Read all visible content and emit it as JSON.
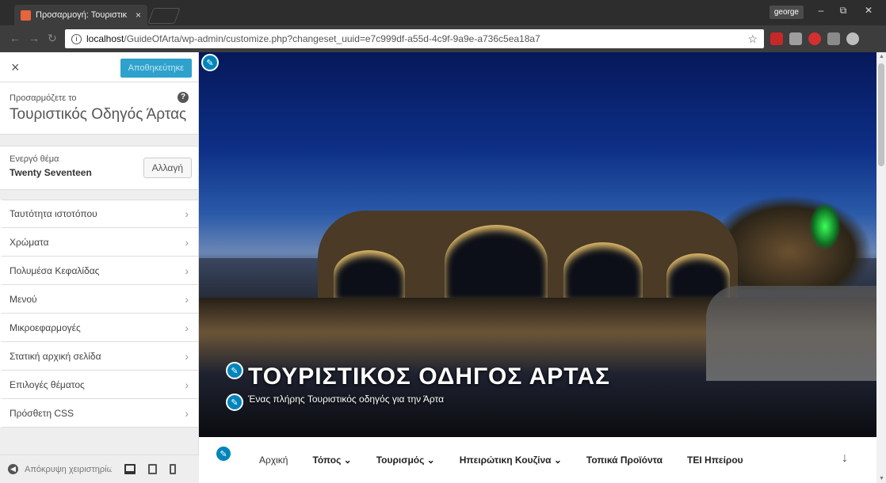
{
  "browser": {
    "tab_title": "Προσαρμογή: Τουριστικ",
    "tab_close": "×",
    "user": "george",
    "url_host": "localhost",
    "url_path": "/GuideOfArta/wp-admin/customize.php?changeset_uuid=e7c999df-a55d-4c9f-9a9e-a736c5ea18a7",
    "window_controls": [
      "–",
      "⧉",
      "✕"
    ]
  },
  "sidebar": {
    "save_label": "Αποθηκεύτηκε",
    "customizing_label": "Προσαρμόζετε το",
    "site_name": "Τουριστικός Οδηγός Άρτας",
    "active_theme_label": "Ενεργό θέμα",
    "theme_name": "Twenty Seventeen",
    "change_label": "Αλλαγή",
    "items": [
      {
        "label": "Ταυτότητα ιστοτόπου"
      },
      {
        "label": "Χρώματα"
      },
      {
        "label": "Πολυμέσα Κεφαλίδας"
      },
      {
        "label": "Μενού"
      },
      {
        "label": "Μικροεφαρμογές"
      },
      {
        "label": "Στατική αρχική σελίδα"
      },
      {
        "label": "Επιλογές θέματος"
      },
      {
        "label": "Πρόσθετη CSS"
      }
    ],
    "hide_controls_label": "Απόκρυψη χειριστηρίων"
  },
  "preview": {
    "site_title": "ΤΟΥΡΙΣΤΙΚΟΣ ΟΔΗΓΟΣ ΑΡΤΑΣ",
    "site_description": "Ένας πλήρης Τουριστικός οδηγός για την Άρτα",
    "menu": [
      {
        "label": "Αρχική"
      },
      {
        "label": "Τόπος ⌄"
      },
      {
        "label": "Τουρισμός ⌄"
      },
      {
        "label": "Ηπειρώτικη Κουζίνα ⌄"
      },
      {
        "label": "Τοπικά Προϊόντα"
      },
      {
        "label": "ΤΕΙ Ηπείρου"
      }
    ],
    "scroll_down_icon": "↓"
  },
  "icons": {
    "close": "×",
    "chevron": "›",
    "help": "?",
    "pencil": "✎"
  },
  "colors": {
    "accent": "#0085ba",
    "save_button": "#2ea2cc"
  }
}
